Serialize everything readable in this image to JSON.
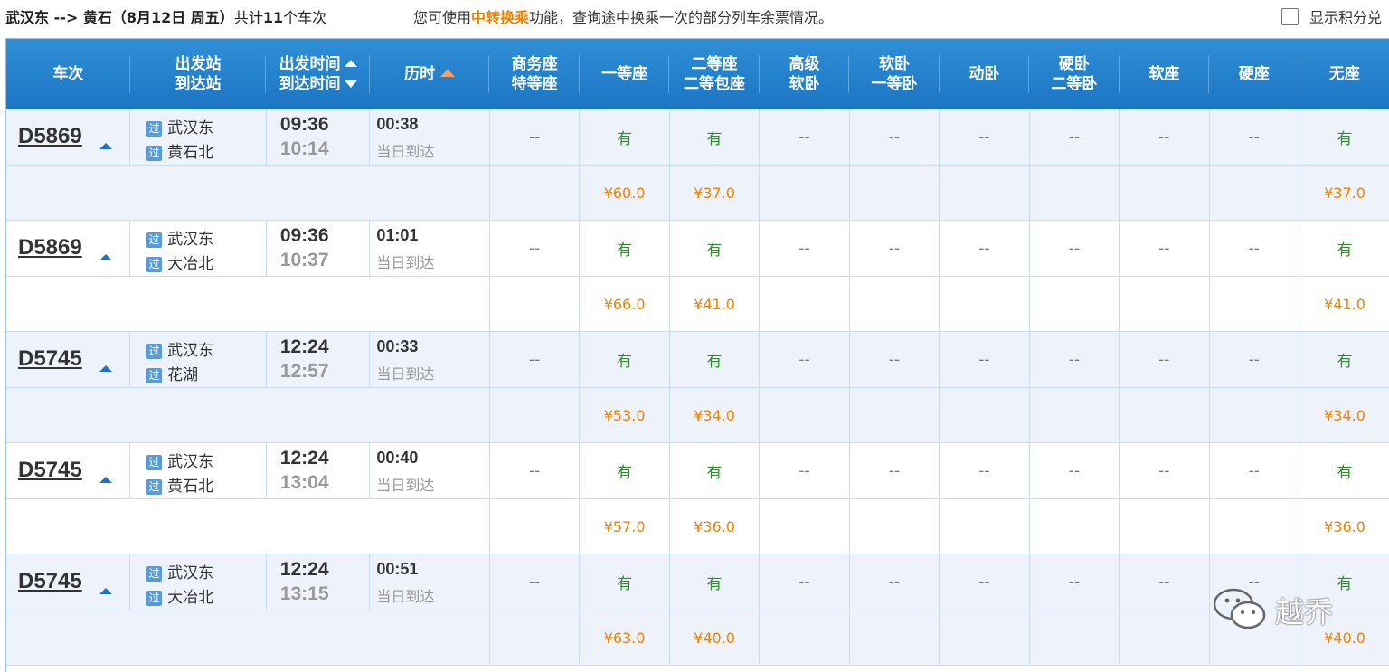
{
  "header": {
    "route": "武汉东 --> 黄石（8月12日  周五）",
    "count_prefix": "共计",
    "count": "11",
    "count_suffix": "个车次",
    "tip_prefix": "您可使用",
    "tip_link": "中转换乘",
    "tip_suffix": "功能，查询途中换乘一次的部分列车余票情况。",
    "points_label": "显示积分兑"
  },
  "columns": {
    "train": "车次",
    "station_from": "出发站",
    "station_to": "到达站",
    "depart_time": "出发时间",
    "arrive_time": "到达时间",
    "duration": "历时",
    "business_a": "商务座",
    "business_b": "特等座",
    "first": "一等座",
    "second_a": "二等座",
    "second_b": "二等包座",
    "deluxe_a": "高级",
    "deluxe_b": "软卧",
    "soft_sleeper_a": "软卧",
    "soft_sleeper_b": "一等卧",
    "moving_sleeper": "动卧",
    "hard_sleeper_a": "硬卧",
    "hard_sleeper_b": "二等卧",
    "soft_seat": "软座",
    "hard_seat": "硬座",
    "no_seat": "无座"
  },
  "station_tag": "过",
  "rows": [
    {
      "train": "D5869",
      "from": "武汉东",
      "to": "黄石北",
      "dep": "09:36",
      "arr": "10:14",
      "dur": "00:38",
      "day": "当日到达",
      "seats": [
        "--",
        "有",
        "有",
        "--",
        "--",
        "--",
        "--",
        "--",
        "--",
        "有"
      ],
      "prices": [
        "",
        "¥60.0",
        "¥37.0",
        "",
        "",
        "",
        "",
        "",
        "",
        "¥37.0"
      ]
    },
    {
      "train": "D5869",
      "from": "武汉东",
      "to": "大冶北",
      "dep": "09:36",
      "arr": "10:37",
      "dur": "01:01",
      "day": "当日到达",
      "seats": [
        "--",
        "有",
        "有",
        "--",
        "--",
        "--",
        "--",
        "--",
        "--",
        "有"
      ],
      "prices": [
        "",
        "¥66.0",
        "¥41.0",
        "",
        "",
        "",
        "",
        "",
        "",
        "¥41.0"
      ]
    },
    {
      "train": "D5745",
      "from": "武汉东",
      "to": "花湖",
      "dep": "12:24",
      "arr": "12:57",
      "dur": "00:33",
      "day": "当日到达",
      "seats": [
        "--",
        "有",
        "有",
        "--",
        "--",
        "--",
        "--",
        "--",
        "--",
        "有"
      ],
      "prices": [
        "",
        "¥53.0",
        "¥34.0",
        "",
        "",
        "",
        "",
        "",
        "",
        "¥34.0"
      ]
    },
    {
      "train": "D5745",
      "from": "武汉东",
      "to": "黄石北",
      "dep": "12:24",
      "arr": "13:04",
      "dur": "00:40",
      "day": "当日到达",
      "seats": [
        "--",
        "有",
        "有",
        "--",
        "--",
        "--",
        "--",
        "--",
        "--",
        "有"
      ],
      "prices": [
        "",
        "¥57.0",
        "¥36.0",
        "",
        "",
        "",
        "",
        "",
        "",
        "¥36.0"
      ]
    },
    {
      "train": "D5745",
      "from": "武汉东",
      "to": "大冶北",
      "dep": "12:24",
      "arr": "13:15",
      "dur": "00:51",
      "day": "当日到达",
      "seats": [
        "--",
        "有",
        "有",
        "--",
        "--",
        "--",
        "--",
        "--",
        "--",
        "有"
      ],
      "prices": [
        "",
        "¥63.0",
        "¥40.0",
        "",
        "",
        "",
        "",
        "",
        "",
        "¥40.0"
      ]
    }
  ],
  "watermark": "越乔"
}
